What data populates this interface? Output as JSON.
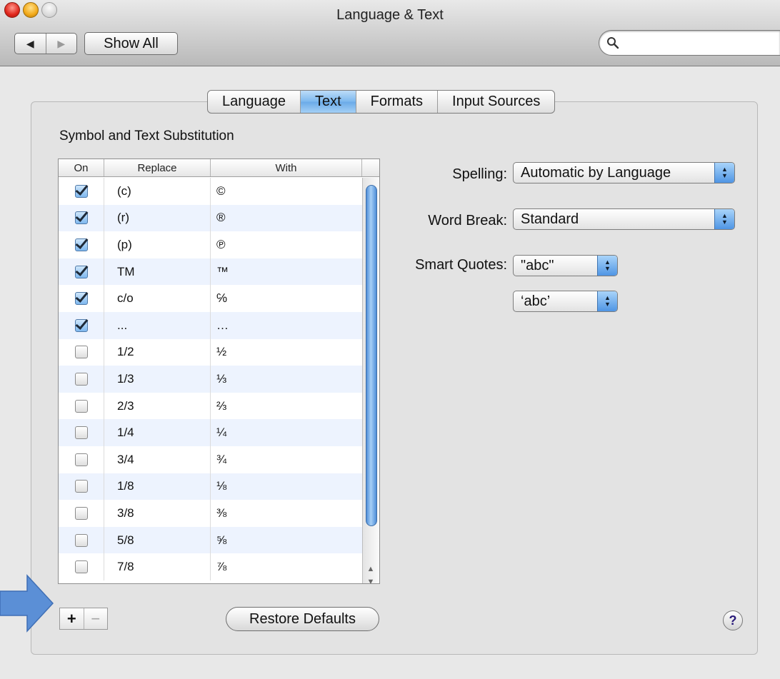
{
  "window": {
    "title": "Language & Text"
  },
  "toolbar": {
    "back_label": "◀",
    "forward_label": "▶",
    "show_all_label": "Show All",
    "search_placeholder": "",
    "search_value": ""
  },
  "tabs": [
    {
      "label": "Language"
    },
    {
      "label": "Text",
      "active": true
    },
    {
      "label": "Formats"
    },
    {
      "label": "Input Sources"
    }
  ],
  "section_title": "Symbol and Text Substitution",
  "table": {
    "columns": [
      "On",
      "Replace",
      "With"
    ],
    "rows": [
      {
        "on": true,
        "replace": "(c)",
        "with": "©"
      },
      {
        "on": true,
        "replace": "(r)",
        "with": "®"
      },
      {
        "on": true,
        "replace": "(p)",
        "with": "℗"
      },
      {
        "on": true,
        "replace": "TM",
        "with": "™"
      },
      {
        "on": true,
        "replace": "c/o",
        "with": "℅"
      },
      {
        "on": true,
        "replace": "...",
        "with": "…"
      },
      {
        "on": false,
        "replace": "1/2",
        "with": "½"
      },
      {
        "on": false,
        "replace": "1/3",
        "with": "⅓"
      },
      {
        "on": false,
        "replace": "2/3",
        "with": "⅔"
      },
      {
        "on": false,
        "replace": "1/4",
        "with": "¼"
      },
      {
        "on": false,
        "replace": "3/4",
        "with": "¾"
      },
      {
        "on": false,
        "replace": "1/8",
        "with": "⅛"
      },
      {
        "on": false,
        "replace": "3/8",
        "with": "⅜"
      },
      {
        "on": false,
        "replace": "5/8",
        "with": "⅝"
      },
      {
        "on": false,
        "replace": "7/8",
        "with": "⅞"
      }
    ]
  },
  "options": {
    "spelling_label": "Spelling:",
    "spelling_value": "Automatic by Language",
    "word_break_label": "Word Break:",
    "word_break_value": "Standard",
    "smart_quotes_label": "Smart Quotes:",
    "double_quotes_value": "\"abc\"",
    "single_quotes_value": "‘abc’"
  },
  "bottom": {
    "add_label": "+",
    "remove_label": "−",
    "restore_defaults_label": "Restore Defaults",
    "help_label": "?"
  },
  "colors": {
    "accent": "#6aaae8",
    "pointer_arrow": "#5b8fd6"
  }
}
